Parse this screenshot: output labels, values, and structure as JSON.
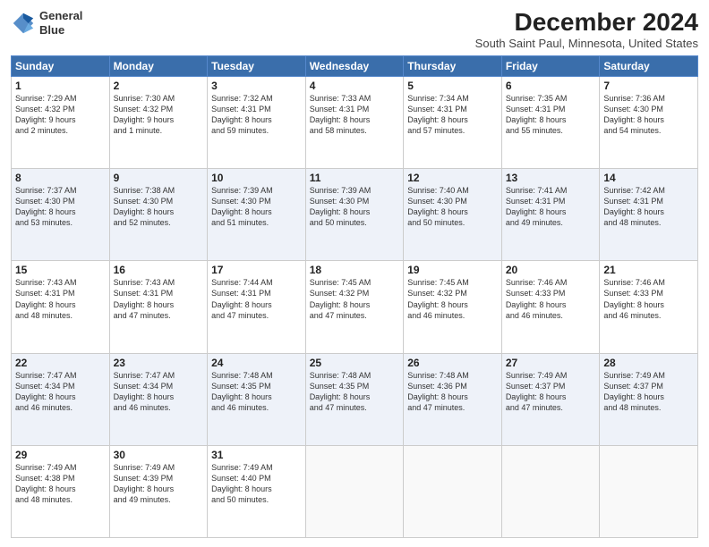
{
  "header": {
    "logo_line1": "General",
    "logo_line2": "Blue",
    "title": "December 2024",
    "subtitle": "South Saint Paul, Minnesota, United States"
  },
  "days_of_week": [
    "Sunday",
    "Monday",
    "Tuesday",
    "Wednesday",
    "Thursday",
    "Friday",
    "Saturday"
  ],
  "weeks": [
    [
      {
        "day": "1",
        "info": "Sunrise: 7:29 AM\nSunset: 4:32 PM\nDaylight: 9 hours\nand 2 minutes."
      },
      {
        "day": "2",
        "info": "Sunrise: 7:30 AM\nSunset: 4:32 PM\nDaylight: 9 hours\nand 1 minute."
      },
      {
        "day": "3",
        "info": "Sunrise: 7:32 AM\nSunset: 4:31 PM\nDaylight: 8 hours\nand 59 minutes."
      },
      {
        "day": "4",
        "info": "Sunrise: 7:33 AM\nSunset: 4:31 PM\nDaylight: 8 hours\nand 58 minutes."
      },
      {
        "day": "5",
        "info": "Sunrise: 7:34 AM\nSunset: 4:31 PM\nDaylight: 8 hours\nand 57 minutes."
      },
      {
        "day": "6",
        "info": "Sunrise: 7:35 AM\nSunset: 4:31 PM\nDaylight: 8 hours\nand 55 minutes."
      },
      {
        "day": "7",
        "info": "Sunrise: 7:36 AM\nSunset: 4:30 PM\nDaylight: 8 hours\nand 54 minutes."
      }
    ],
    [
      {
        "day": "8",
        "info": "Sunrise: 7:37 AM\nSunset: 4:30 PM\nDaylight: 8 hours\nand 53 minutes."
      },
      {
        "day": "9",
        "info": "Sunrise: 7:38 AM\nSunset: 4:30 PM\nDaylight: 8 hours\nand 52 minutes."
      },
      {
        "day": "10",
        "info": "Sunrise: 7:39 AM\nSunset: 4:30 PM\nDaylight: 8 hours\nand 51 minutes."
      },
      {
        "day": "11",
        "info": "Sunrise: 7:39 AM\nSunset: 4:30 PM\nDaylight: 8 hours\nand 50 minutes."
      },
      {
        "day": "12",
        "info": "Sunrise: 7:40 AM\nSunset: 4:30 PM\nDaylight: 8 hours\nand 50 minutes."
      },
      {
        "day": "13",
        "info": "Sunrise: 7:41 AM\nSunset: 4:31 PM\nDaylight: 8 hours\nand 49 minutes."
      },
      {
        "day": "14",
        "info": "Sunrise: 7:42 AM\nSunset: 4:31 PM\nDaylight: 8 hours\nand 48 minutes."
      }
    ],
    [
      {
        "day": "15",
        "info": "Sunrise: 7:43 AM\nSunset: 4:31 PM\nDaylight: 8 hours\nand 48 minutes."
      },
      {
        "day": "16",
        "info": "Sunrise: 7:43 AM\nSunset: 4:31 PM\nDaylight: 8 hours\nand 47 minutes."
      },
      {
        "day": "17",
        "info": "Sunrise: 7:44 AM\nSunset: 4:31 PM\nDaylight: 8 hours\nand 47 minutes."
      },
      {
        "day": "18",
        "info": "Sunrise: 7:45 AM\nSunset: 4:32 PM\nDaylight: 8 hours\nand 47 minutes."
      },
      {
        "day": "19",
        "info": "Sunrise: 7:45 AM\nSunset: 4:32 PM\nDaylight: 8 hours\nand 46 minutes."
      },
      {
        "day": "20",
        "info": "Sunrise: 7:46 AM\nSunset: 4:33 PM\nDaylight: 8 hours\nand 46 minutes."
      },
      {
        "day": "21",
        "info": "Sunrise: 7:46 AM\nSunset: 4:33 PM\nDaylight: 8 hours\nand 46 minutes."
      }
    ],
    [
      {
        "day": "22",
        "info": "Sunrise: 7:47 AM\nSunset: 4:34 PM\nDaylight: 8 hours\nand 46 minutes."
      },
      {
        "day": "23",
        "info": "Sunrise: 7:47 AM\nSunset: 4:34 PM\nDaylight: 8 hours\nand 46 minutes."
      },
      {
        "day": "24",
        "info": "Sunrise: 7:48 AM\nSunset: 4:35 PM\nDaylight: 8 hours\nand 46 minutes."
      },
      {
        "day": "25",
        "info": "Sunrise: 7:48 AM\nSunset: 4:35 PM\nDaylight: 8 hours\nand 47 minutes."
      },
      {
        "day": "26",
        "info": "Sunrise: 7:48 AM\nSunset: 4:36 PM\nDaylight: 8 hours\nand 47 minutes."
      },
      {
        "day": "27",
        "info": "Sunrise: 7:49 AM\nSunset: 4:37 PM\nDaylight: 8 hours\nand 47 minutes."
      },
      {
        "day": "28",
        "info": "Sunrise: 7:49 AM\nSunset: 4:37 PM\nDaylight: 8 hours\nand 48 minutes."
      }
    ],
    [
      {
        "day": "29",
        "info": "Sunrise: 7:49 AM\nSunset: 4:38 PM\nDaylight: 8 hours\nand 48 minutes."
      },
      {
        "day": "30",
        "info": "Sunrise: 7:49 AM\nSunset: 4:39 PM\nDaylight: 8 hours\nand 49 minutes."
      },
      {
        "day": "31",
        "info": "Sunrise: 7:49 AM\nSunset: 4:40 PM\nDaylight: 8 hours\nand 50 minutes."
      },
      {
        "day": "",
        "info": ""
      },
      {
        "day": "",
        "info": ""
      },
      {
        "day": "",
        "info": ""
      },
      {
        "day": "",
        "info": ""
      }
    ]
  ]
}
